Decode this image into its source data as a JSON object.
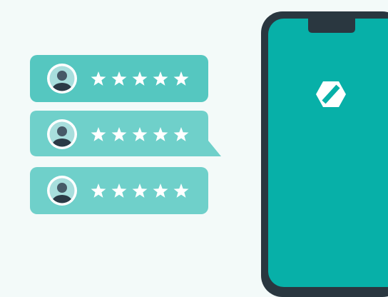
{
  "colors": {
    "background": "#f3faf9",
    "card_primary": "#55c7c0",
    "card_secondary": "#6fd0ca",
    "star": "#ffffff",
    "avatar_ring": "#ffffff",
    "avatar_inner": "#a8dedd",
    "avatar_figure": "#475a68",
    "avatar_torso": "#2b3a46",
    "phone_frame": "#2a3740",
    "phone_screen": "#07b0a8",
    "logo": "#ffffff"
  },
  "reviews": [
    {
      "rating": 5,
      "max_rating": 5,
      "avatar_icon": "user-avatar-icon"
    },
    {
      "rating": 5,
      "max_rating": 5,
      "avatar_icon": "user-avatar-icon"
    },
    {
      "rating": 5,
      "max_rating": 5,
      "avatar_icon": "user-avatar-icon"
    }
  ],
  "phone": {
    "logo_icon": "app-logo-icon"
  }
}
